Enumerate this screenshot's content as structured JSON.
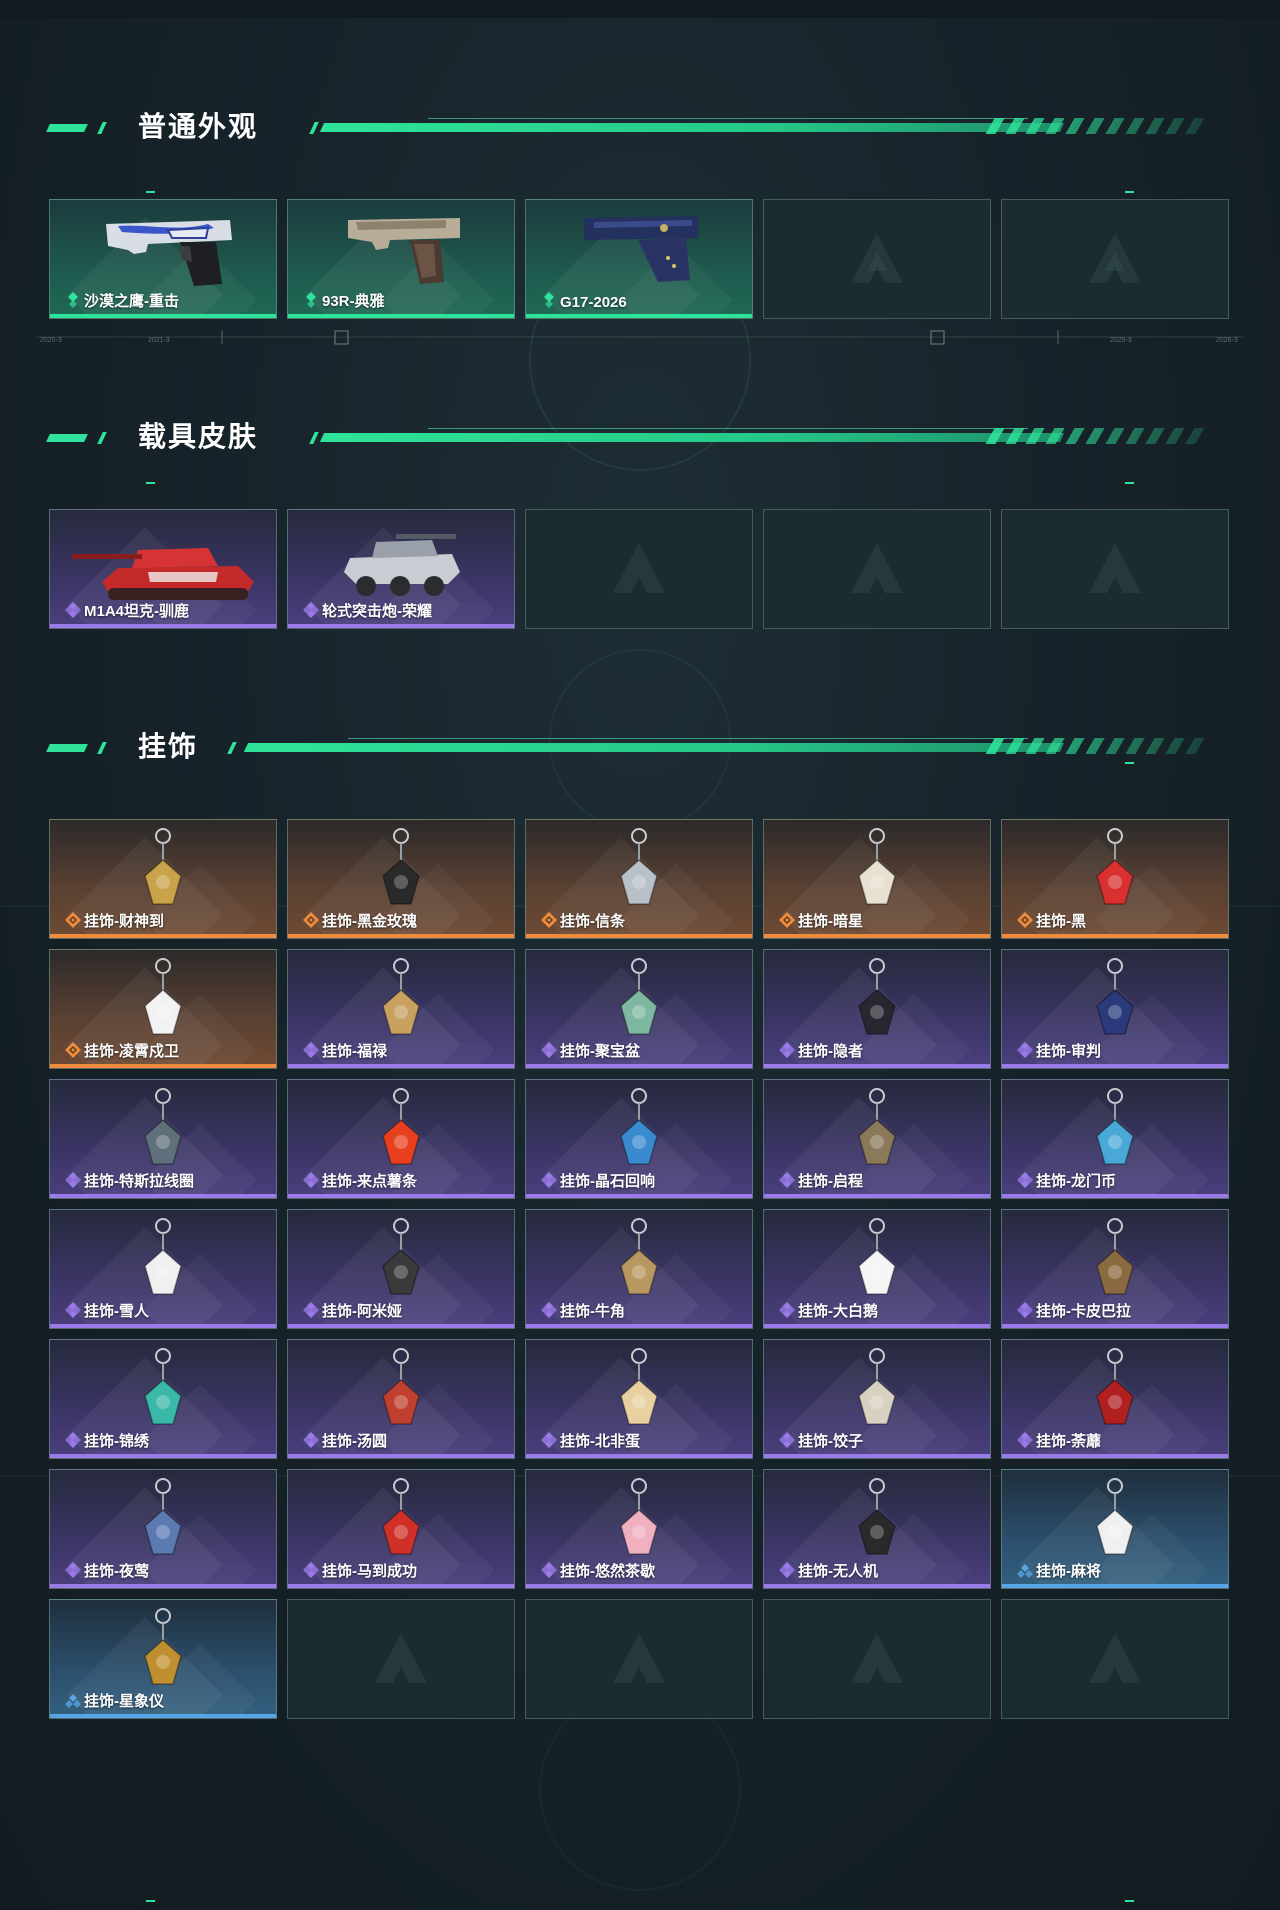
{
  "sections": {
    "normal": {
      "title": "普通外观",
      "items": [
        "沙漠之鹰-重击",
        "93R-典雅",
        "G17-2026"
      ]
    },
    "vehicle": {
      "title": "载具皮肤",
      "items": [
        "M1A4坦克-驯鹿",
        "轮式突击炮-荣耀"
      ]
    },
    "pendant": {
      "title": "挂饰",
      "items": [
        "挂饰-财神到",
        "挂饰-黑金玫瑰",
        "挂饰-信条",
        "挂饰-暗星",
        "挂饰-黑",
        "挂饰-凌霄戍卫",
        "挂饰-福禄",
        "挂饰-聚宝盆",
        "挂饰-隐者",
        "挂饰-审判",
        "挂饰-特斯拉线圈",
        "挂饰-来点薯条",
        "挂饰-晶石回响",
        "挂饰-启程",
        "挂饰-龙门币",
        "挂饰-雪人",
        "挂饰-阿米娅",
        "挂饰-牛角",
        "挂饰-大白鹅",
        "挂饰-卡皮巴拉",
        "挂饰-锦绣",
        "挂饰-汤圆",
        "挂饰-北非蛋",
        "挂饰-饺子",
        "挂饰-荼蘼",
        "挂饰-夜莺",
        "挂饰-马到成功",
        "挂饰-悠然茶歇",
        "挂饰-无人机",
        "挂饰-麻将",
        "挂饰-星象仪"
      ]
    }
  },
  "rarity_colors": {
    "green": "#2fe39a",
    "purple": "#9b7bea",
    "orange": "#f08a3c",
    "blue": "#58a4e6"
  },
  "timeline_labels": [
    "2020-3",
    "2021-3",
    "2025-3",
    "2026-3"
  ]
}
